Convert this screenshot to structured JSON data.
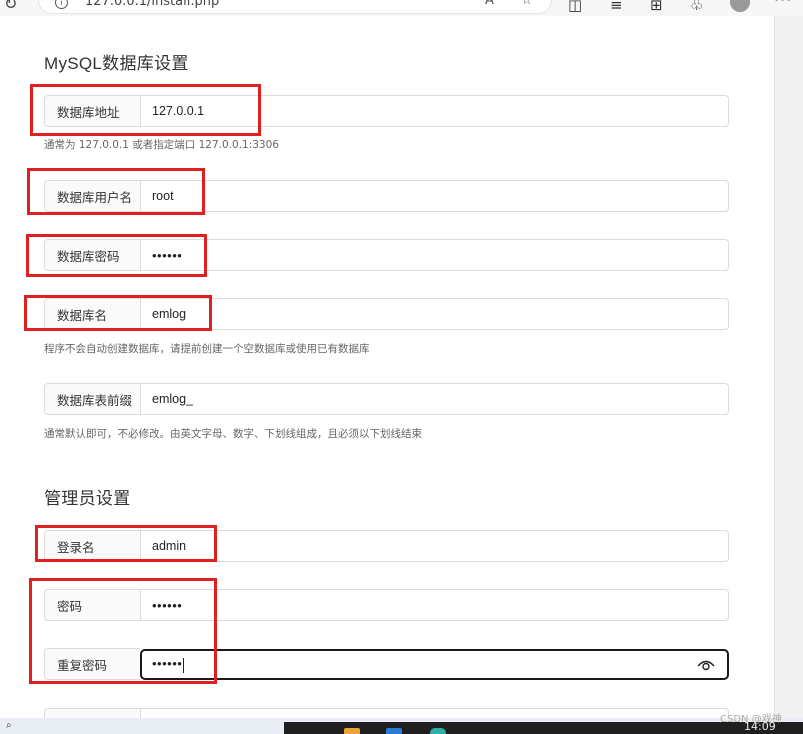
{
  "browser": {
    "url": "127.0.0.1/install.php"
  },
  "mysql": {
    "title": "MySQL数据库设置",
    "host": {
      "label": "数据库地址",
      "value": "127.0.0.1",
      "hint": "通常为 127.0.0.1 或者指定端口 127.0.0.1:3306"
    },
    "user": {
      "label": "数据库用户名",
      "value": "root"
    },
    "password": {
      "label": "数据库密码",
      "value": "••••••"
    },
    "dbname": {
      "label": "数据库名",
      "value": "emlog",
      "hint": "程序不会自动创建数据库，请提前创建一个空数据库或使用已有数据库"
    },
    "prefix": {
      "label": "数据库表前缀",
      "value": "emlog_",
      "hint": "通常默认即可，不必修改。由英文字母、数字、下划线组成，且必须以下划线结束"
    }
  },
  "admin": {
    "title": "管理员设置",
    "login": {
      "label": "登录名",
      "value": "admin"
    },
    "password": {
      "label": "密码",
      "value": "••••••"
    },
    "repeat": {
      "label": "重复密码",
      "value": "••••••"
    }
  },
  "taskbar": {
    "time": "14:09",
    "watermark": "CSDN @戏神"
  },
  "colors": {
    "annotation": "#e02020",
    "focus_border": "#1a1a1a"
  }
}
